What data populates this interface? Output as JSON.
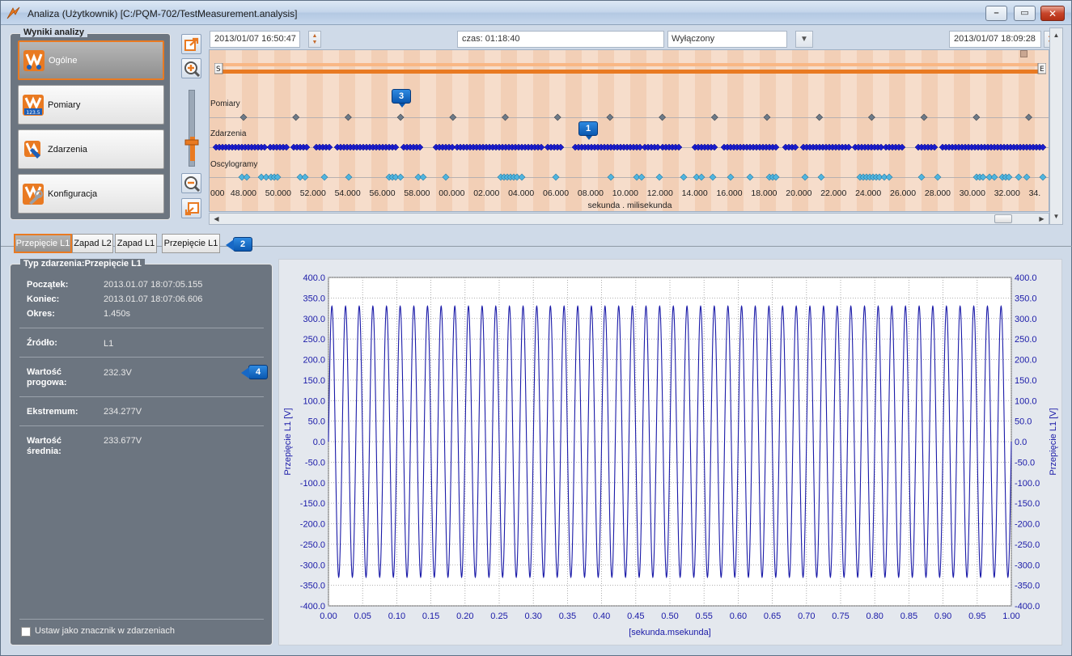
{
  "window": {
    "title": "Analiza (Użytkownik) [C:/PQM-702/TestMeasurement.analysis]"
  },
  "nav": {
    "legend": "Wyniki analizy",
    "items": [
      {
        "label": "Ogólne",
        "active": true,
        "icon": "general-analysis-icon"
      },
      {
        "label": "Pomiary",
        "active": false,
        "icon": "measurements-icon"
      },
      {
        "label": "Zdarzenia",
        "active": false,
        "icon": "events-icon"
      },
      {
        "label": "Konfiguracja",
        "active": false,
        "icon": "configuration-icon"
      }
    ]
  },
  "toolbar": {
    "icons": [
      "zoom-to-selection-icon",
      "zoom-in-icon",
      "zoom-slider",
      "zoom-out-icon",
      "zoom-reset-icon"
    ]
  },
  "top": {
    "start_date": "2013/01/07 16:50:47",
    "duration": "czas: 01:18:40",
    "filter": "Wyłączony",
    "end_date": "2013/01/07 18:09:28"
  },
  "timeline": {
    "range_start_marker": "S",
    "range_end_marker": "E",
    "tracks": [
      "Pomiary",
      "Zdarzenia",
      "Oscylogramy"
    ],
    "ticks": [
      "000",
      "48.000",
      "50.000",
      "52.000",
      "54.000",
      "56.000",
      "58.000",
      "00.000",
      "02.000",
      "04.000",
      "06.000",
      "08.000",
      "10.000",
      "12.000",
      "14.000",
      "16.000",
      "18.000",
      "20.000",
      "22.000",
      "24.000",
      "26.000",
      "28.000",
      "30.000",
      "32.000",
      "34."
    ],
    "axis_caption": "sekunda . milisekunda",
    "colors": {
      "measurement": "#6d7a88",
      "event": "#1a1ccc",
      "oscillogram": "#4fb5df",
      "range": "#e97a22"
    }
  },
  "badges": [
    "1",
    "2",
    "3",
    "4"
  ],
  "tabs": [
    {
      "label": "Przepięcie L1",
      "active": true
    },
    {
      "label": "Zapad L2",
      "active": false
    },
    {
      "label": "Zapad L1",
      "active": false
    },
    {
      "label": "Przepięcie L1",
      "active": false
    }
  ],
  "details": {
    "legend": "Typ zdarzenia:Przepięcie L1",
    "start_label": "Początek:",
    "start_value": "2013.01.07  18:07:05.155",
    "end_label": "Koniec:",
    "end_value": "2013.01.07  18:07:06.606",
    "period_label": "Okres:",
    "period_value": "1.450s",
    "source_label": "Źródło:",
    "source_value": "L1",
    "threshold_label_1": "Wartość",
    "threshold_label_2": "progowa:",
    "threshold_value": "232.3V",
    "extremum_label": "Ekstremum:",
    "extremum_value": "234.277V",
    "average_label_1": "Wartość",
    "average_label_2": "średnia:",
    "average_value": "233.677V",
    "marker_checkbox": "Ustaw jako znacznik w zdarzeniach"
  },
  "chart_data": {
    "type": "line",
    "xlabel": "[sekunda.msekunda]",
    "ylabel_left": "Przepięcie L1 [V]",
    "ylabel_right": "Przepięcie L1 [V]",
    "xlim": [
      0.0,
      1.0
    ],
    "ylim": [
      -400.0,
      400.0
    ],
    "x_ticks": [
      "0.00",
      "0.05",
      "0.10",
      "0.15",
      "0.20",
      "0.25",
      "0.30",
      "0.35",
      "0.40",
      "0.45",
      "0.50",
      "0.55",
      "0.60",
      "0.65",
      "0.70",
      "0.75",
      "0.80",
      "0.85",
      "0.90",
      "0.95",
      "1.00"
    ],
    "y_ticks": [
      "400.0",
      "350.0",
      "300.0",
      "250.0",
      "200.0",
      "150.0",
      "100.0",
      "50.0",
      "0.0",
      "-50.0",
      "-100.0",
      "-150.0",
      "-200.0",
      "-250.0",
      "-300.0",
      "-350.0",
      "-400.0"
    ],
    "grid": true,
    "series": [
      {
        "color": "#1a1aa8",
        "frequency_hz": 50,
        "amplitude_v": 330,
        "offset_v": 0
      }
    ]
  }
}
